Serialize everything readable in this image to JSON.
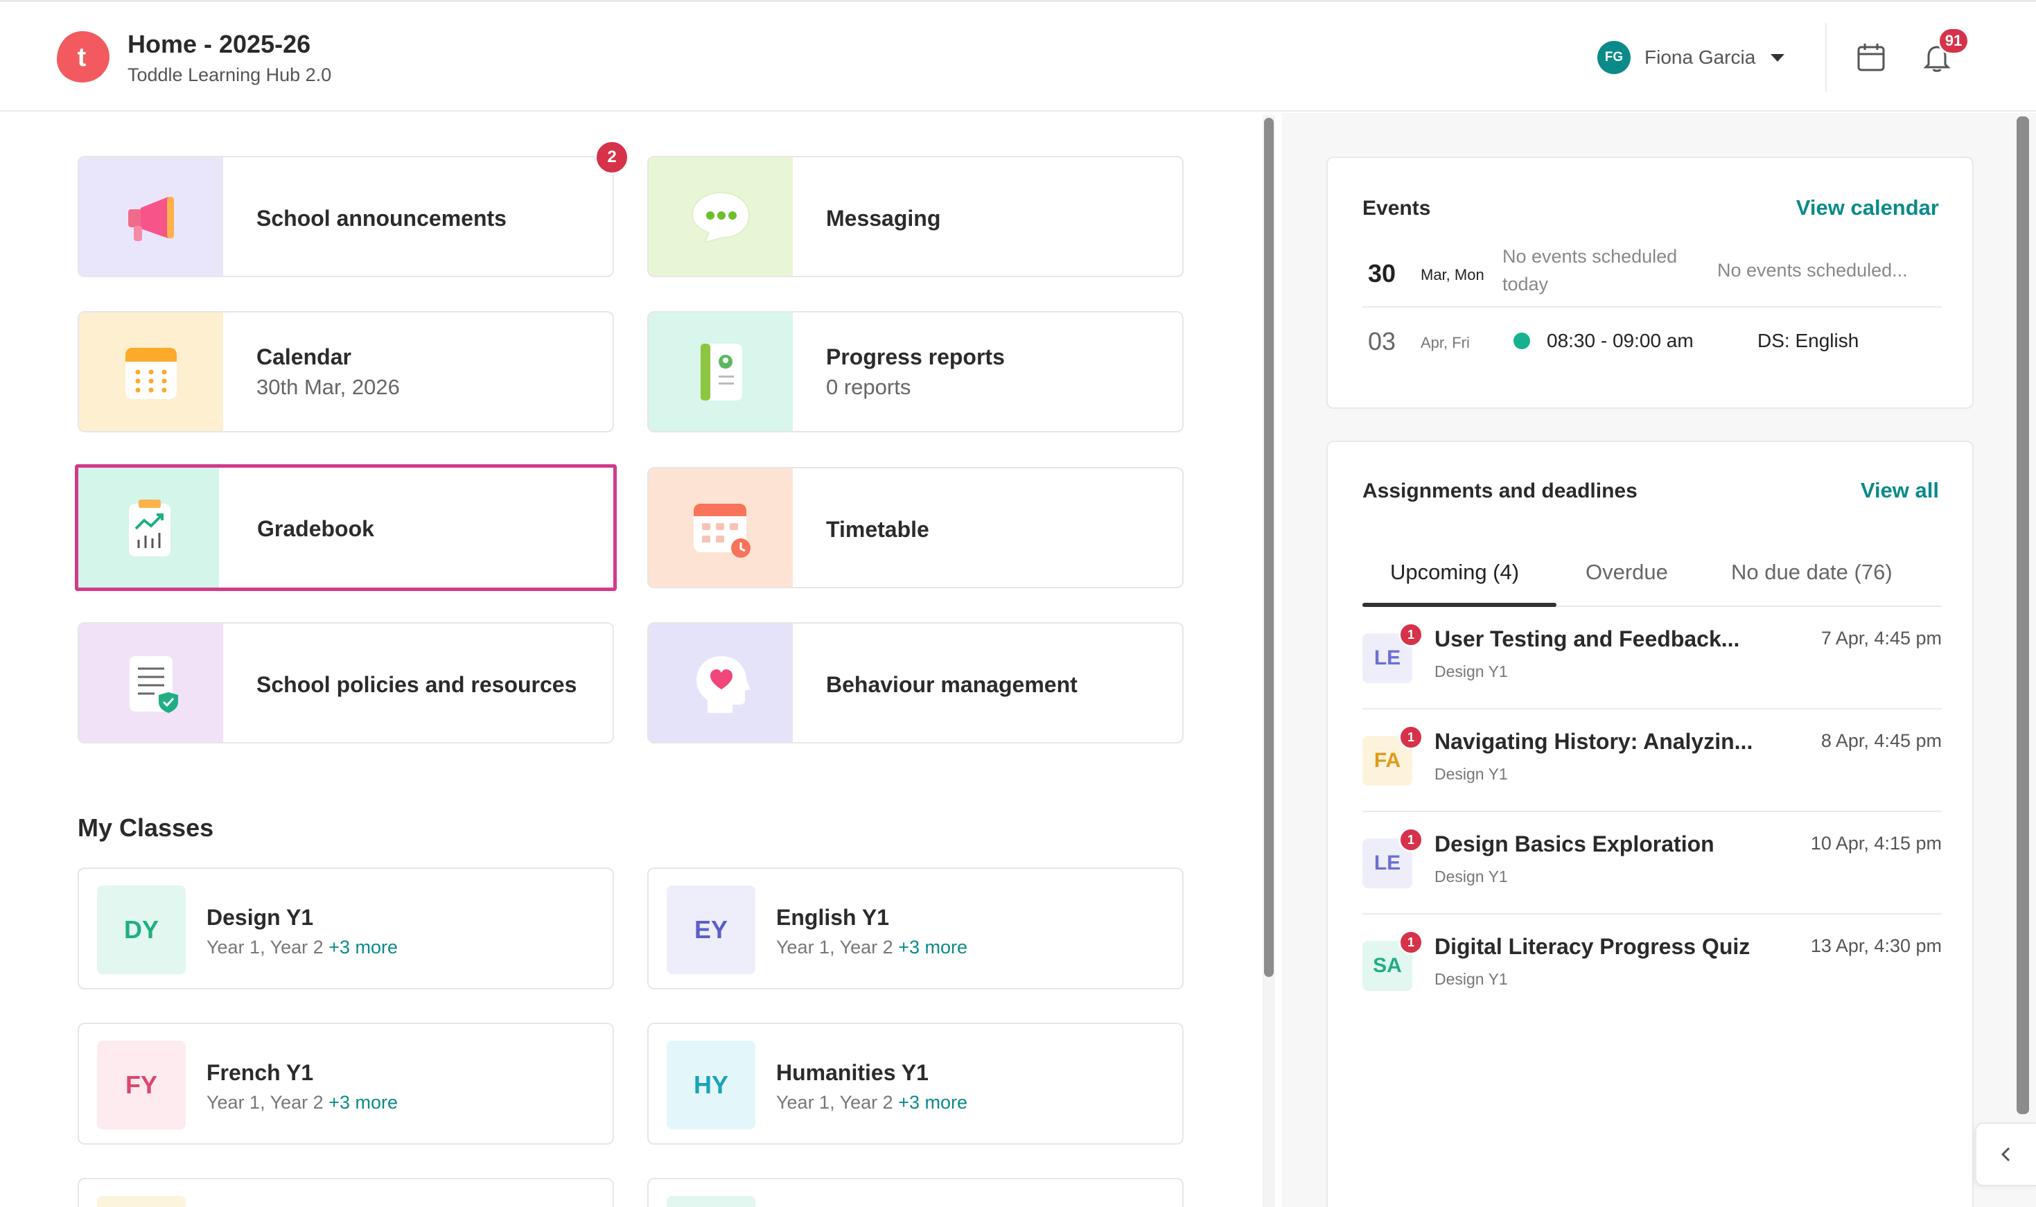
{
  "header": {
    "logo_letter": "t",
    "title": "Home - 2025-26",
    "subtitle": "Toddle Learning Hub 2.0",
    "user": {
      "initials": "FG",
      "name": "Fiona Garcia"
    },
    "notification_count": "91"
  },
  "tiles": [
    {
      "title": "School announcements",
      "badge": "2",
      "icon": "megaphone-icon"
    },
    {
      "title": "Messaging",
      "icon": "chat-bubble-icon"
    },
    {
      "title": "Calendar",
      "subtitle": "30th Mar, 2026",
      "icon": "calendar-icon"
    },
    {
      "title": "Progress reports",
      "subtitle": "0 reports",
      "icon": "report-icon"
    },
    {
      "title": "Gradebook",
      "icon": "gradebook-chart-icon"
    },
    {
      "title": "Timetable",
      "icon": "timetable-icon"
    },
    {
      "title": "School policies and resources",
      "icon": "policy-document-icon"
    },
    {
      "title": "Behaviour management",
      "icon": "head-heart-icon"
    }
  ],
  "my_classes": {
    "title": "My Classes",
    "classes": [
      {
        "initials": "DY",
        "name": "Design Y1",
        "years": "Year 1, Year 2",
        "more": "+3 more"
      },
      {
        "initials": "EY",
        "name": "English Y1",
        "years": "Year 1, Year 2",
        "more": "+3 more"
      },
      {
        "initials": "FY",
        "name": "French Y1",
        "years": "Year 1, Year 2",
        "more": "+3 more"
      },
      {
        "initials": "HY",
        "name": "Humanities Y1",
        "years": "Year 1, Year 2",
        "more": "+3 more"
      }
    ]
  },
  "events": {
    "title": "Events",
    "link": "View calendar",
    "rows": [
      {
        "day": "30",
        "date": "Mar, Mon",
        "note": "No events scheduled today",
        "note2": "No events scheduled..."
      },
      {
        "day": "03",
        "date": "Apr, Fri",
        "time": "08:30 - 09:00 am",
        "name": "DS: English"
      }
    ]
  },
  "assignments": {
    "title": "Assignments and deadlines",
    "link": "View all",
    "tabs": [
      "Upcoming (4)",
      "Overdue",
      "No due date (76)"
    ],
    "items": [
      {
        "initials": "LE",
        "badge": "1",
        "title": "User Testing and Feedback...",
        "class": "Design Y1",
        "due": "7 Apr, 4:45 pm"
      },
      {
        "initials": "FA",
        "badge": "1",
        "title": "Navigating History: Analyzin...",
        "class": "Design Y1",
        "due": "8 Apr, 4:45 pm"
      },
      {
        "initials": "LE",
        "badge": "1",
        "title": "Design Basics Exploration",
        "class": "Design Y1",
        "due": "10 Apr, 4:15 pm"
      },
      {
        "initials": "SA",
        "badge": "1",
        "title": "Digital Literacy Progress Quiz",
        "class": "Design Y1",
        "due": "13 Apr, 4:30 pm"
      }
    ]
  },
  "colors": {
    "accent": "#0b8a8a",
    "badge": "#d6324a",
    "selected_outline": "#d13a8a"
  }
}
